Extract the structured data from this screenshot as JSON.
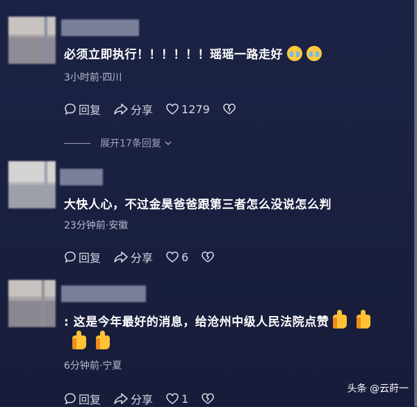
{
  "comments": [
    {
      "text": "必须立即执行！！！！！！瑶瑶一路走好",
      "emojis": [
        "crying-face",
        "crying-face"
      ],
      "meta": "3小时前·四川",
      "reply_label": "回复",
      "share_label": "分享",
      "likes": "1279",
      "expand_label": "展开17条回复"
    },
    {
      "text": "大快人心，不过金昊爸爸跟第三者怎么没说怎么判",
      "meta": "23分钟前·安徽",
      "reply_label": "回复",
      "share_label": "分享",
      "likes": "6"
    },
    {
      "text": ": 这是今年最好的消息，给沧州中级人民法院点赞",
      "emojis": [
        "thumbs-up",
        "thumbs-up",
        "thumbs-up",
        "thumbs-up"
      ],
      "meta": "6分钟前·宁夏",
      "reply_label": "回复",
      "share_label": "分享",
      "likes": "1"
    }
  ],
  "watermark": "头条 @云莳一",
  "colors": {
    "background": "#1a2040",
    "meta": "#b8bdd0",
    "action": "#d5d8e4"
  }
}
